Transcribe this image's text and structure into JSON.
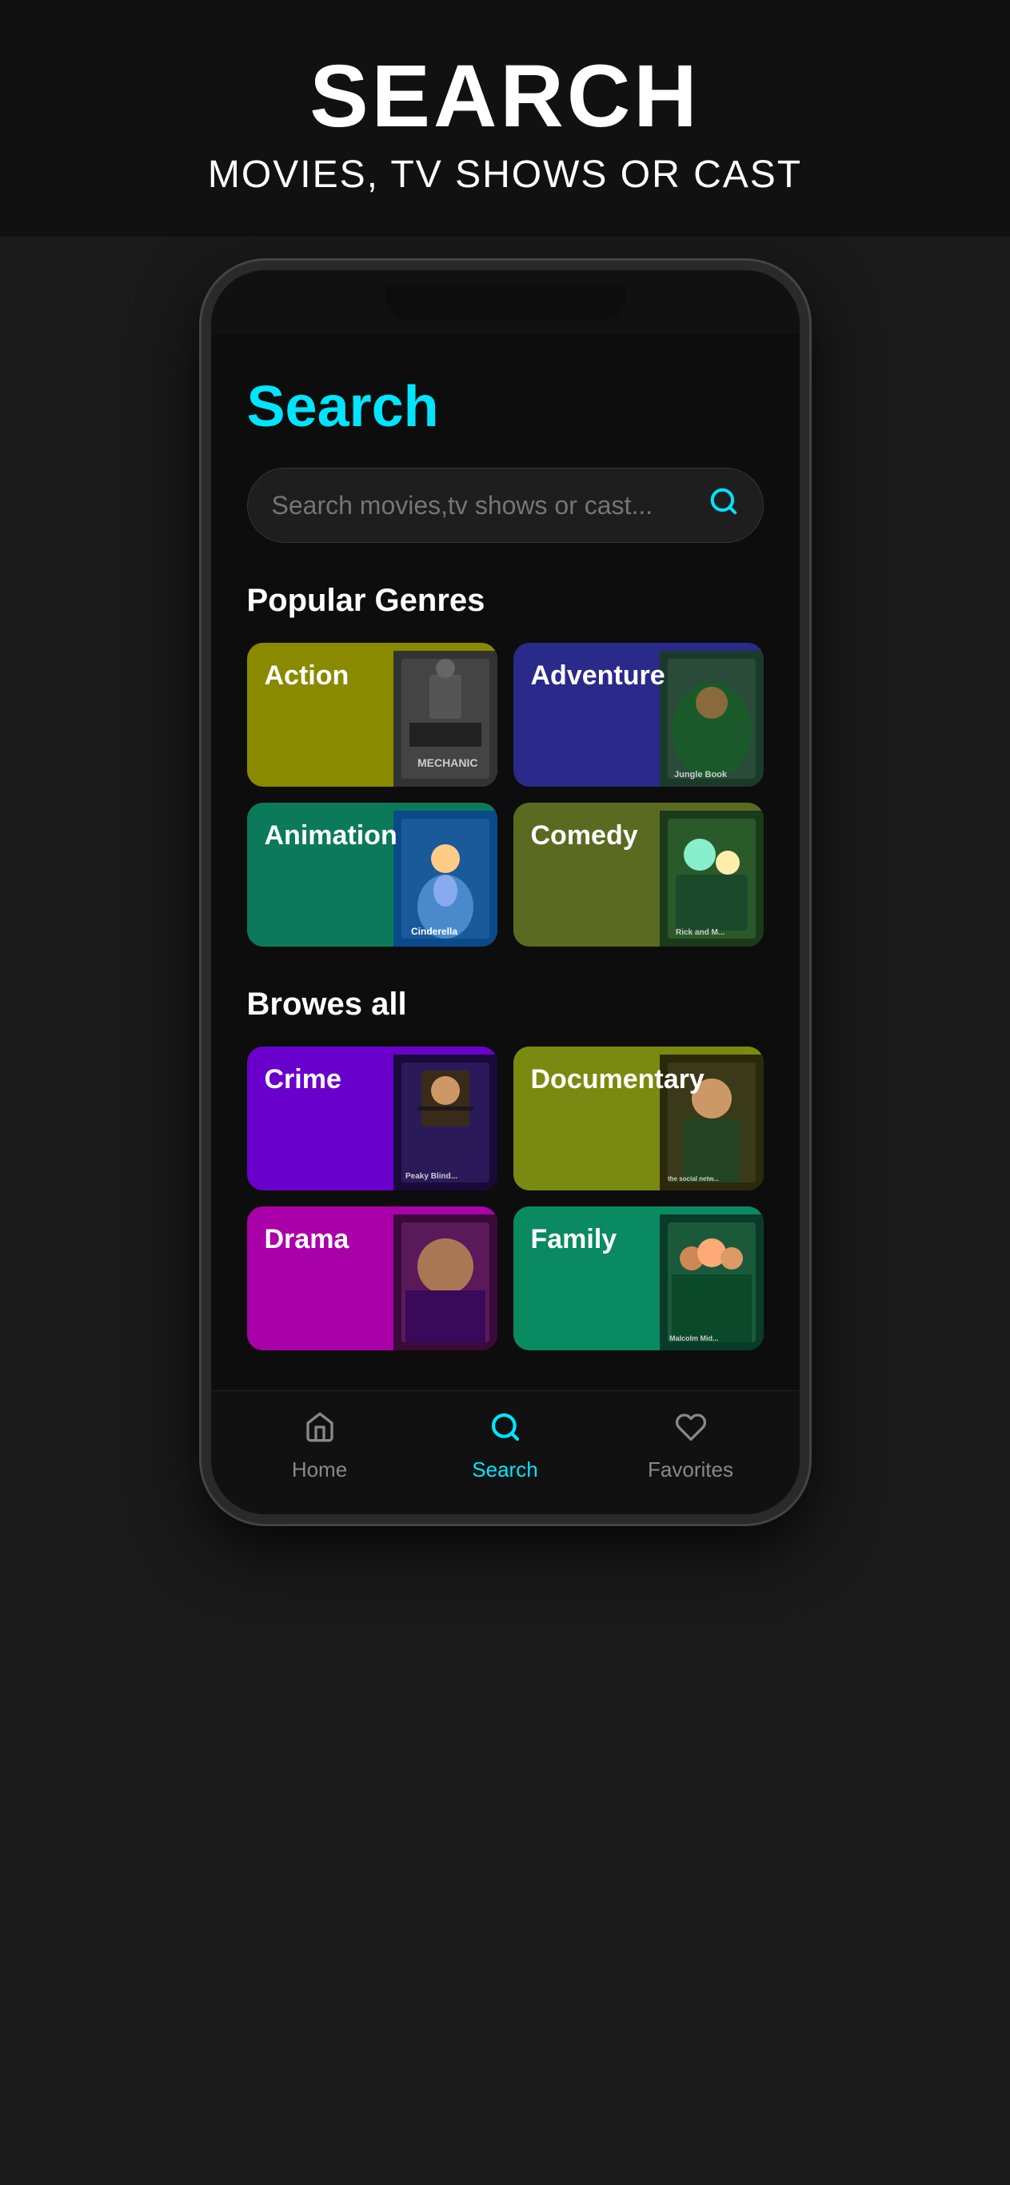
{
  "banner": {
    "title": "SEARCH",
    "subtitle": "MOVIES, TV SHOWS OR CAST"
  },
  "screen": {
    "page_title": "Search",
    "search_placeholder": "Search movies,tv shows or cast...",
    "popular_genres_title": "Popular Genres",
    "browse_all_title": "Browes all",
    "genres_popular": [
      {
        "id": "action",
        "label": "Action",
        "color_class": "genre-action"
      },
      {
        "id": "adventure",
        "label": "Adventure",
        "color_class": "genre-adventure"
      },
      {
        "id": "animation",
        "label": "Animation",
        "color_class": "genre-animation"
      },
      {
        "id": "comedy",
        "label": "Comedy",
        "color_class": "genre-comedy"
      }
    ],
    "genres_browse": [
      {
        "id": "crime",
        "label": "Crime",
        "color_class": "genre-crime"
      },
      {
        "id": "documentary",
        "label": "Documentary",
        "color_class": "genre-documentary"
      },
      {
        "id": "drama",
        "label": "Drama",
        "color_class": "genre-drama"
      },
      {
        "id": "family",
        "label": "Family",
        "color_class": "genre-family"
      }
    ],
    "nav": {
      "items": [
        {
          "id": "home",
          "label": "Home",
          "active": false
        },
        {
          "id": "search",
          "label": "Search",
          "active": true
        },
        {
          "id": "favorites",
          "label": "Favorites",
          "active": false
        }
      ]
    }
  }
}
